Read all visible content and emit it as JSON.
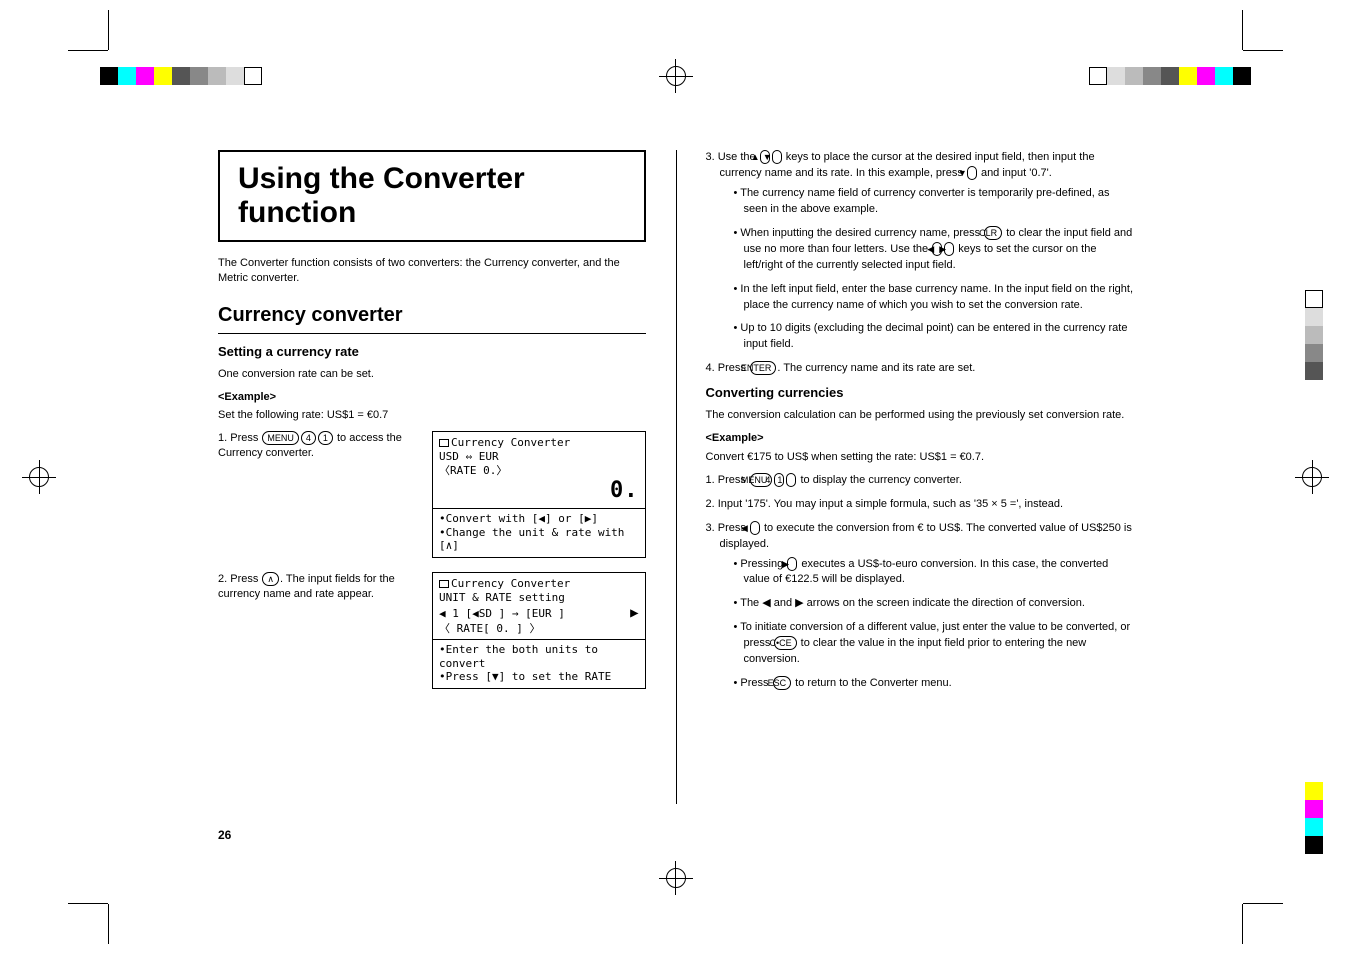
{
  "title": "Using the Converter function",
  "intro": "The Converter function consists of two converters: the Currency converter, and the Metric converter.",
  "section_heading": "Currency converter",
  "sub_heading_1": "Setting a currency rate",
  "set_rate_1": "One conversion rate can be set.",
  "example_label": "<Example>",
  "set_rate_2": "Set the following rate: US$1 = €0.7",
  "step1_prefix": "1. Press ",
  "keys": {
    "menu": "MENU",
    "k4": "4",
    "k1": "1",
    "up_arrow": "▲",
    "down_arrow": "▼",
    "left": "◀",
    "right": "▶",
    "enter": "ENTER",
    "clr": "CLR",
    "cce": "C•CE",
    "esc": "ESC",
    "caret": "∧"
  },
  "step1_suffix": " to access the Currency converter.",
  "step2_prefix": "2. Press ",
  "step2_suffix": ". The input fields for the currency name and rate appear.",
  "screen1": {
    "line1": "Currency Converter",
    "line2": "USD  ⇔  EUR",
    "line3": "〈RATE 0.〉",
    "big": "0.",
    "hint1": "•Convert with [◀] or [▶]",
    "hint2": "•Change the unit & rate with [∧]"
  },
  "screen2": {
    "line1": "Currency Converter",
    "line2": " UNIT & RATE setting",
    "row_l": "◀ 1 [◀SD ] → [EUR ]",
    "row_r": "▶",
    "rate": "〈 RATE[          0. ]     〉",
    "hint1": "•Enter the both units to convert",
    "hint2": "•Press [▼] to set the RATE"
  },
  "right": {
    "step3_a": "3. Use the ",
    "step3_b": " keys to place the cursor at the desired input field, then input the currency name and its rate. In this example, press ",
    "step3_c": " and input '0.7'.",
    "b1": "The currency name field of currency converter is temporarily pre-defined, as seen in the above example.",
    "b2_a": "When inputting the desired currency name, press ",
    "b2_b": " to clear the input field and use no more than four letters. Use the ",
    "b2_c": " keys to set the cursor on the left/right of the currently selected input field.",
    "b3": "In the left input field, enter the base currency name. In the input field on the right, place the currency name of which you wish to set the conversion rate.",
    "b4": "Up to 10 digits (excluding the decimal point) can be entered in the currency rate input field.",
    "step4_a": "4. Press ",
    "step4_b": ". The currency name and its rate are set.",
    "conv_heading": "Converting currencies",
    "conv_intro": "The conversion calculation can be performed using the previously set conversion rate.",
    "conv_example": "Convert €175 to US$ when setting the rate: US$1 = €0.7.",
    "c1_a": "1. Press ",
    "c1_b": " to display the currency converter.",
    "c2": "2. Input '175'. You may input a simple formula, such as '35 × 5 =', instead.",
    "c3_a": "3. Press ",
    "c3_b": " to execute the conversion from € to US$. The converted value of US$250 is displayed.",
    "cb1_a": "Pressing ",
    "cb1_b": " executes a US$-to-euro conversion. In this case, the converted value of €122.5 will be displayed.",
    "cb2": "The ◀ and ▶ arrows on the screen indicate the direction of conversion.",
    "cb3_a": "To initiate conversion of a different value, just enter the value to be converted, or press ",
    "cb3_b": " to clear the value in the input field prior to entering the new conversion.",
    "cb4_a": "Press ",
    "cb4_b": " to return to the Converter menu."
  },
  "page_number": "26"
}
